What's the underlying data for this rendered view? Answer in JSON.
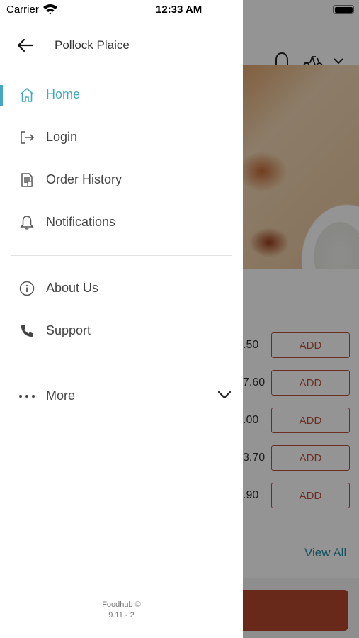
{
  "status_bar": {
    "carrier": "Carrier",
    "time": "12:33 AM"
  },
  "drawer": {
    "restaurant_name": "Pollock Plaice",
    "accent_color": "#45a8c0",
    "menu": [
      {
        "id": "home",
        "label": "Home",
        "icon": "home-icon",
        "active": true
      },
      {
        "id": "login",
        "label": "Login",
        "icon": "login-icon",
        "active": false
      },
      {
        "id": "order-history",
        "label": "Order History",
        "icon": "receipt-icon",
        "active": false
      },
      {
        "id": "notifications",
        "label": "Notifications",
        "icon": "bell-icon",
        "active": false
      }
    ],
    "secondary_menu": [
      {
        "id": "about-us",
        "label": "About Us",
        "icon": "info-icon"
      },
      {
        "id": "support",
        "label": "Support",
        "icon": "phone-icon"
      }
    ],
    "more": {
      "label": "More",
      "icon": "chevron-down-icon"
    },
    "footer": {
      "copyright": "Foodhub ©",
      "version": "9.11 - 2"
    }
  },
  "background": {
    "prices": [
      ".50",
      "7.60",
      ".00",
      "3.70",
      ".90"
    ],
    "add_label": "ADD",
    "view_all": "View All",
    "brand_color": "#b5513b"
  }
}
